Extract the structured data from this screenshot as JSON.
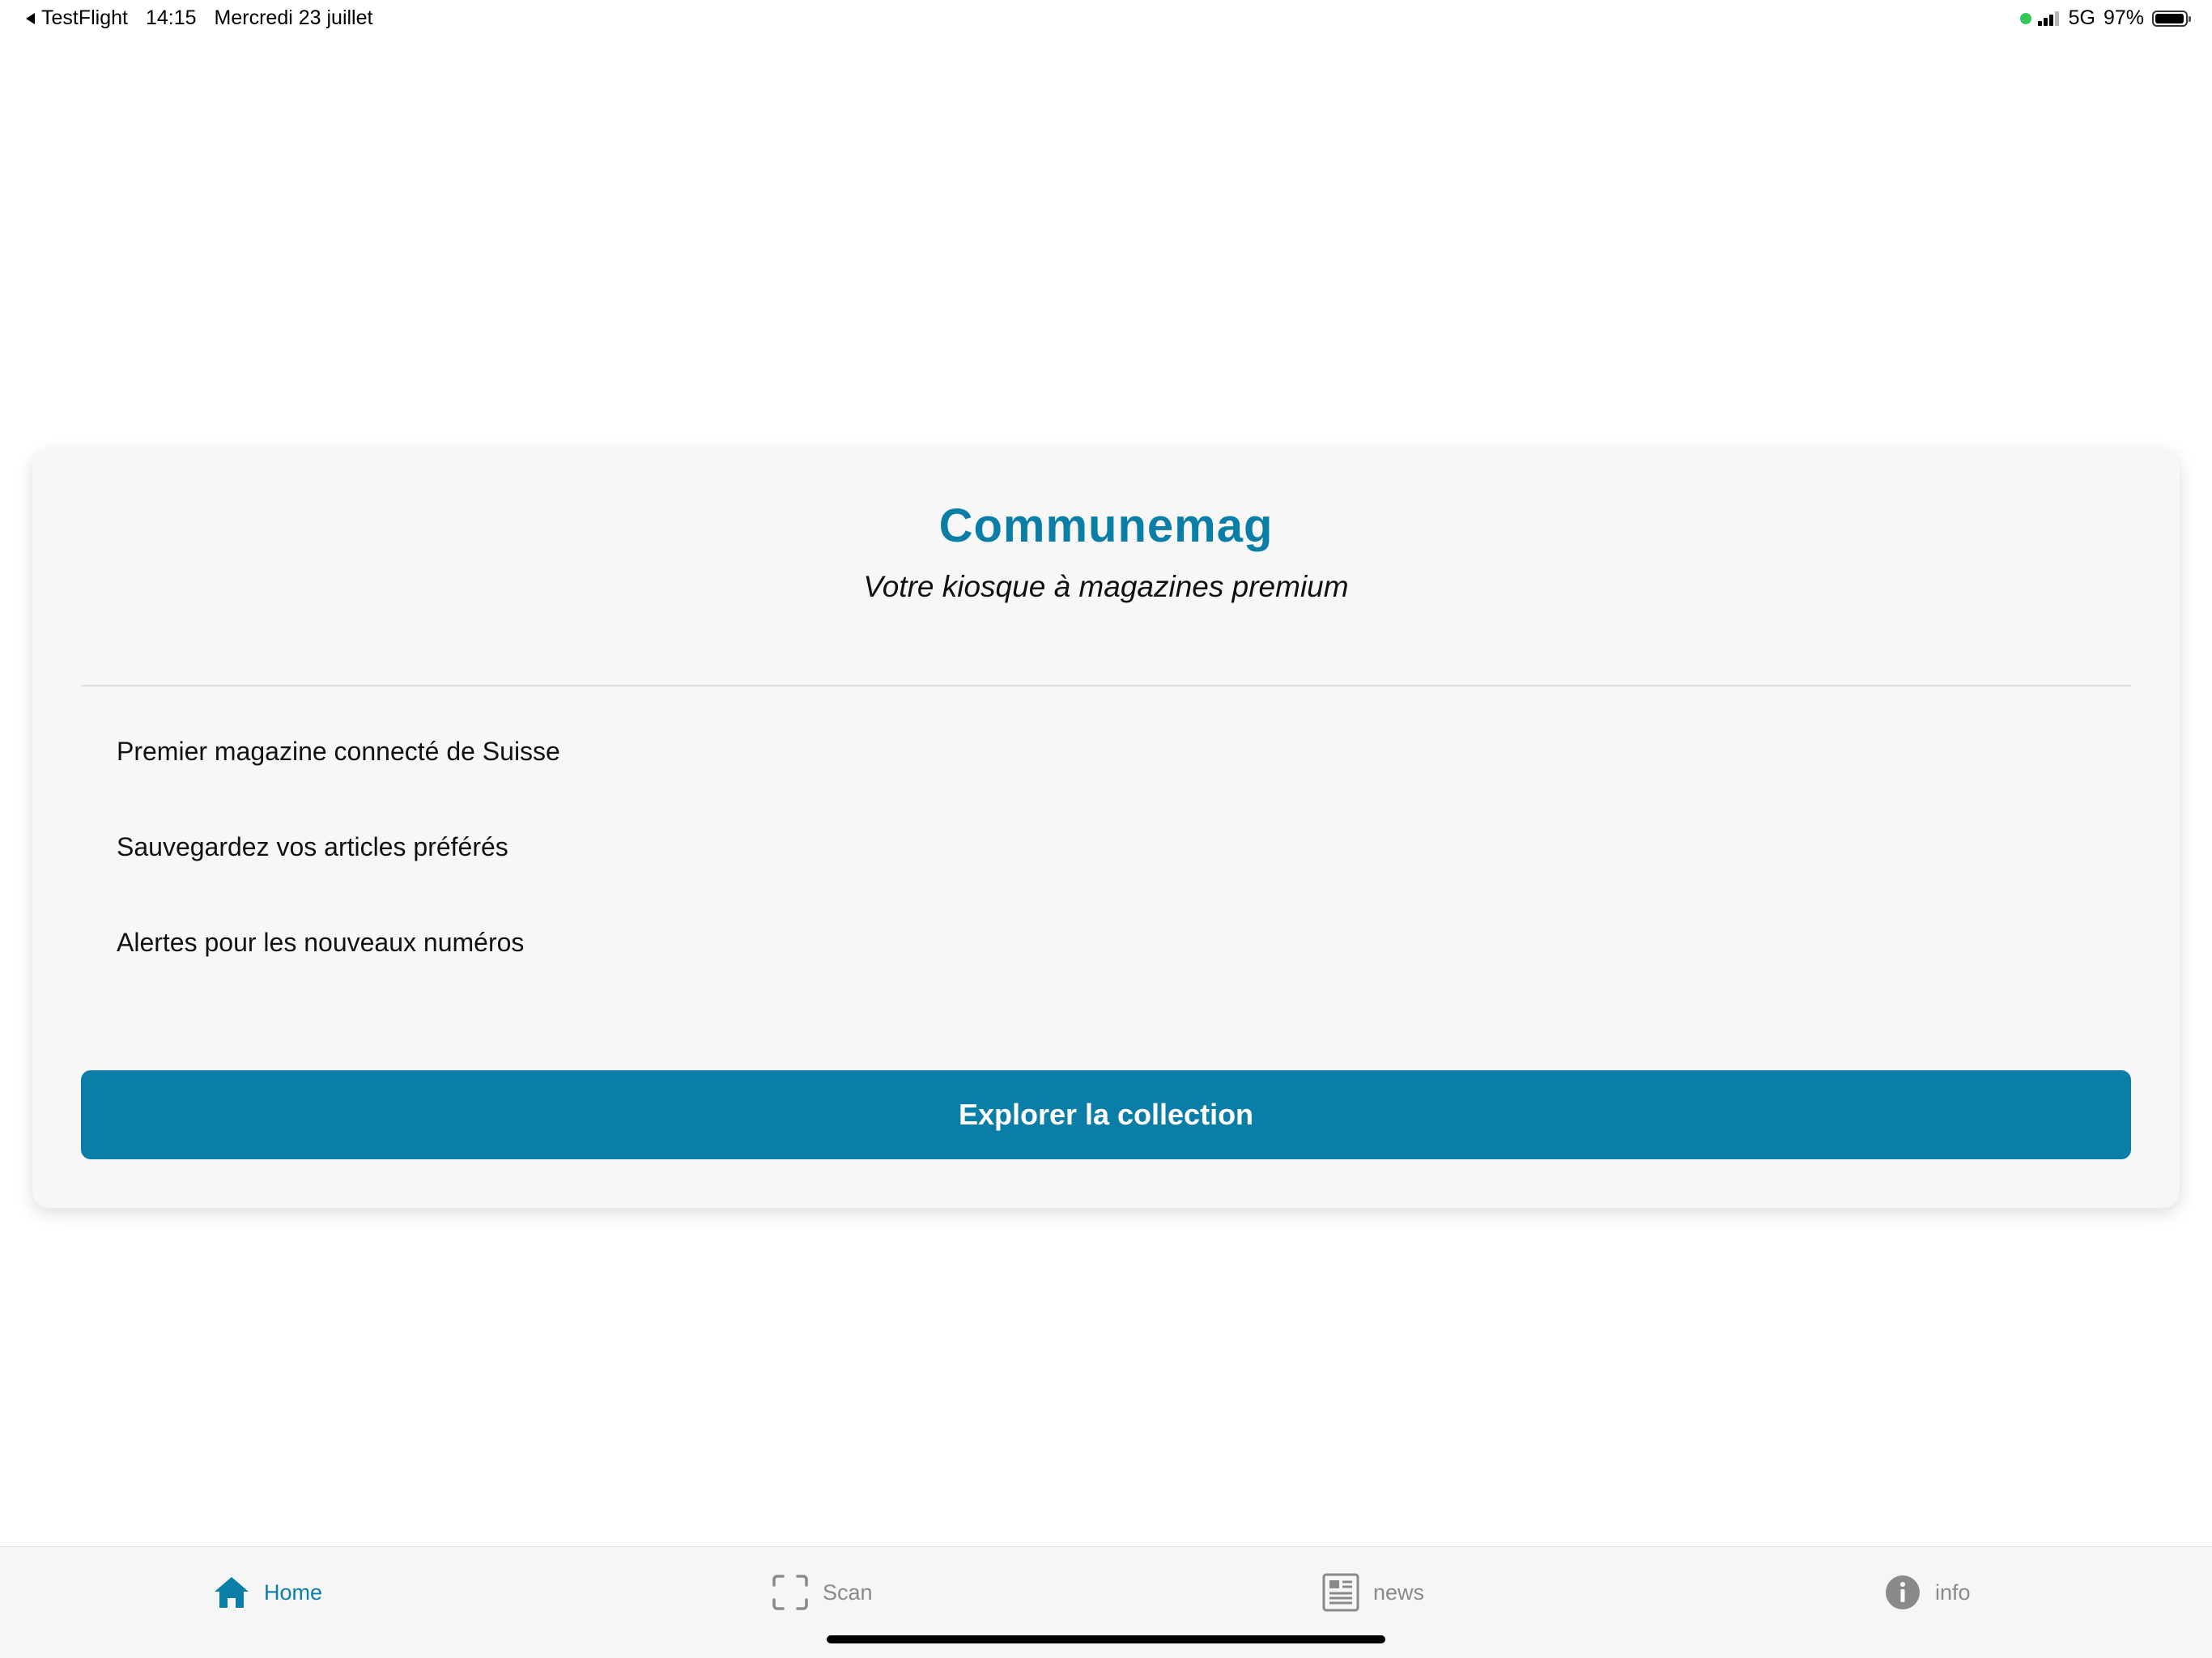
{
  "status_bar": {
    "back_app": "TestFlight",
    "time": "14:15",
    "date": "Mercredi 23 juillet",
    "network": "5G",
    "battery": "97%",
    "battery_level": 0.97
  },
  "card": {
    "title": "Communemag",
    "subtitle": "Votre kiosque à magazines premium",
    "features": [
      "Premier magazine connecté de Suisse",
      "Sauvegardez vos articles préférés",
      "Alertes pour les nouveaux numéros"
    ],
    "cta_label": "Explorer la collection"
  },
  "tab_bar": {
    "tabs": [
      {
        "label": "Home",
        "icon": "home-icon",
        "active": true
      },
      {
        "label": "Scan",
        "icon": "scan-icon",
        "active": false
      },
      {
        "label": "news",
        "icon": "newspaper-icon",
        "active": false
      },
      {
        "label": "info",
        "icon": "info-icon",
        "active": false
      }
    ]
  },
  "colors": {
    "accent": "#0b7ea7",
    "inactive_tab": "#8a8a8a",
    "card_background": "#f7f7f7"
  }
}
